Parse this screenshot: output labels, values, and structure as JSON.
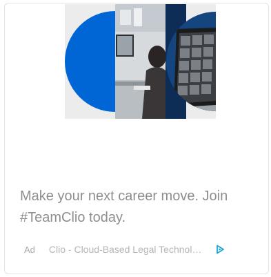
{
  "ad": {
    "image_icon": "team-video-call-photo",
    "headline": "Make your next career move. Join #TeamClio today.",
    "ad_label": "Ad",
    "source": "Clio - Cloud-Based Legal Technology",
    "adchoices_icon": "adchoices-triangle-icon",
    "colors": {
      "accent_blue": "#0066d6",
      "adchoices": "#1aa6d4",
      "headline_text": "#8e8e8e",
      "meta_text": "#b3b3b3"
    }
  }
}
